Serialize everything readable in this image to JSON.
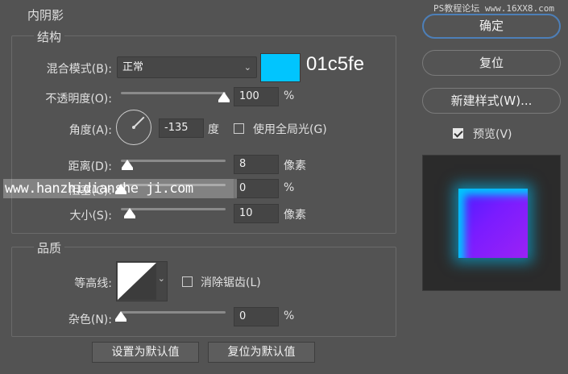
{
  "watermark_top": "PS教程论坛 www.16XX8.com",
  "watermark_mid": "www.hanzhidianshe ji.com",
  "panel": {
    "title": "内阴影",
    "structure": {
      "title": "结构",
      "blend_mode_label": "混合模式(B):",
      "blend_mode_value": "正常",
      "color_hex_label": "01c5fe",
      "color": "#01c5fe",
      "opacity_label": "不透明度(O):",
      "opacity_value": "100",
      "opacity_unit": "%",
      "opacity_level": 1.0,
      "angle_label": "角度(A):",
      "angle_value": "-135",
      "angle_unit": "度",
      "global_light_label": "使用全局光(G)",
      "distance_label": "距离(D):",
      "distance_value": "8",
      "distance_unit": "像素",
      "choke_label": "阻塞(C):",
      "choke_value": "0",
      "choke_unit": "%",
      "size_label": "大小(S):",
      "size_value": "10",
      "size_unit": "像素"
    },
    "quality": {
      "title": "品质",
      "contour_label": "等高线:",
      "antialias_label": "消除锯齿(L)",
      "noise_label": "杂色(N):",
      "noise_value": "0",
      "noise_unit": "%"
    },
    "set_default_label": "设置为默认值",
    "reset_default_label": "复位为默认值"
  },
  "right": {
    "ok_label": "确定",
    "reset_label": "复位",
    "new_style_label": "新建样式(W)...",
    "preview_label": "预览(V)",
    "preview_checked": true
  }
}
